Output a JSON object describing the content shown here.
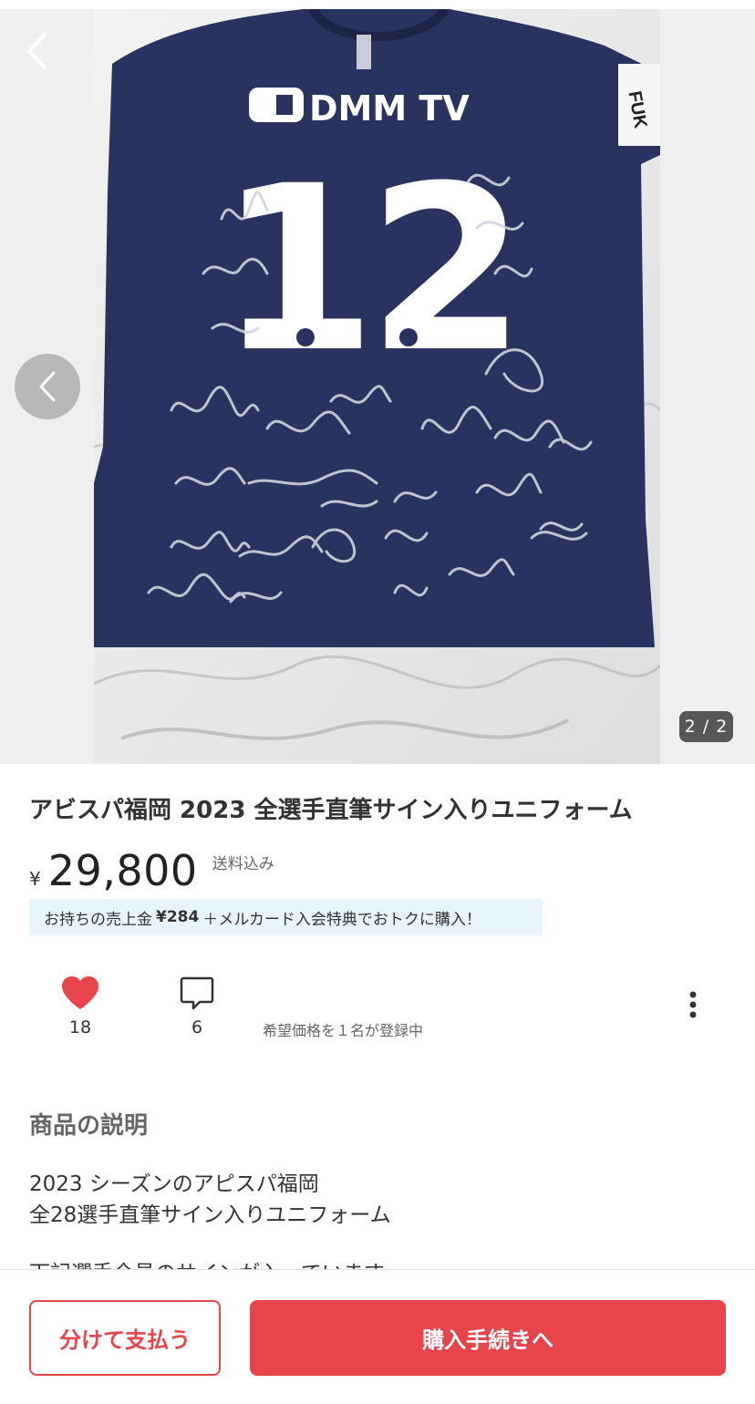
{
  "carousel": {
    "counter": "2 / 2",
    "current_index": 2,
    "total": 2,
    "photo": {
      "sponsor_logo_text": "DMM TV",
      "jersey_number": "12",
      "sleeve_badge_text": "FUK",
      "jersey_color": "#2a3360"
    }
  },
  "product": {
    "title": "アビスパ福岡 2023 全選手直筆サイン入りユニフォーム",
    "currency_symbol": "¥",
    "price": "29,800",
    "shipping": "送料込み"
  },
  "promo": {
    "prefix": "お持ちの売上金",
    "amount": "¥284",
    "suffix": "＋メルカード入会特典でおトクに購入！"
  },
  "stats": {
    "likes": "18",
    "comments": "6",
    "offer_text": "希望価格を１名が登録中"
  },
  "description": {
    "heading": "商品の説明",
    "lines": [
      "2023 シーズンのアピスパ福岡",
      "全28選手直筆サイン入りユニフォーム"
    ],
    "cut_line": "下記選手全員のサインが入っています"
  },
  "actions": {
    "split_pay_label": "分けて支払う",
    "buy_label": "購入手続きへ"
  },
  "colors": {
    "accent_red": "#e8444c",
    "promo_bg": "#e8f4fc"
  }
}
